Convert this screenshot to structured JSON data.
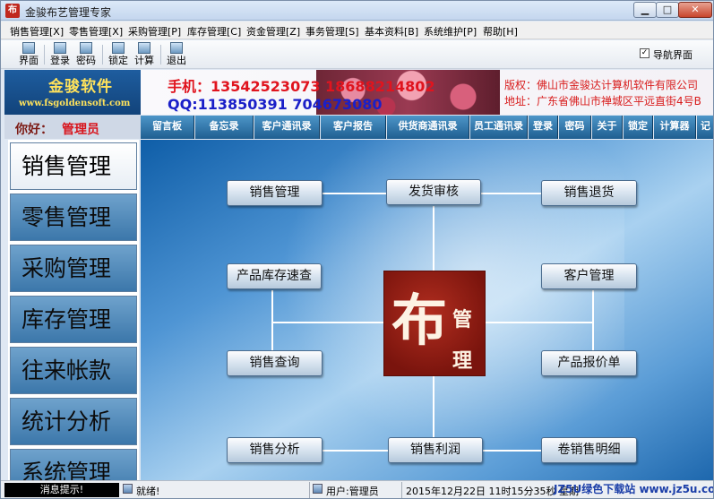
{
  "window": {
    "title": "金骏布艺管理专家",
    "icon_text": "布"
  },
  "window_controls": {
    "minimize": "▁",
    "maximize": "□",
    "close": "✕"
  },
  "menu": [
    "销售管理[X]",
    "零售管理[X]",
    "采购管理[P]",
    "库存管理[C]",
    "资金管理[Z]",
    "事务管理[S]",
    "基本资料[B]",
    "系统维护[P]",
    "帮助[H]"
  ],
  "toolbar": {
    "items": [
      {
        "label": "界面",
        "icon": "interface-icon"
      },
      {
        "label": "登录",
        "icon": "login-icon"
      },
      {
        "label": "密码",
        "icon": "password-icon"
      },
      {
        "label": "锁定",
        "icon": "lock-icon"
      },
      {
        "label": "计算",
        "icon": "calculator-icon"
      },
      {
        "label": "退出",
        "icon": "exit-icon"
      }
    ],
    "nav_checkbox": {
      "checked": true,
      "mark": "✓",
      "label": "导航界面"
    }
  },
  "banner": {
    "logo_name": "金骏软件",
    "logo_url": "www.fsgoldensoft.com",
    "phone": "手机：13542523073  18688214802",
    "qq": "QQ:113850391  704673080",
    "copyright": "版权：佛山市金骏达计算机软件有限公司",
    "address": "地址：广东省佛山市禅城区平远直街4号B"
  },
  "greeting": {
    "label": "你好：",
    "user": "管理员"
  },
  "quick_buttons": [
    "留言板",
    "备忘录",
    "客户通讯录",
    "客户报告",
    "供货商通讯录",
    "员工通讯录",
    "登录",
    "密码",
    "关于",
    "锁定",
    "计算器",
    "记"
  ],
  "sidebar": {
    "items": [
      {
        "label": "销售管理",
        "active": true
      },
      {
        "label": "零售管理",
        "active": false
      },
      {
        "label": "采购管理",
        "active": false
      },
      {
        "label": "库存管理",
        "active": false
      },
      {
        "label": "往来帐款",
        "active": false
      },
      {
        "label": "统计分析",
        "active": false
      },
      {
        "label": "系统管理",
        "active": false
      }
    ]
  },
  "flow": {
    "buttons": {
      "sales_mgmt": "销售管理",
      "ship_review": "发货审核",
      "sales_return": "销售退货",
      "stock_quick": "产品库存速查",
      "customer_mgmt": "客户管理",
      "sales_query": "销售查询",
      "price_list": "产品报价单",
      "sales_analysis": "销售分析",
      "sales_profit": "销售利润",
      "roll_detail": "卷销售明细"
    },
    "center_logo": {
      "big": "布",
      "top": "管",
      "bottom": "理"
    }
  },
  "status": {
    "message_label": "消息提示!",
    "ready": "就绪!",
    "user": "用户:管理员",
    "datetime": "2015年12月22日  11时15分35秒  星期",
    "watermark": "JZ5U绿色下载站 www.jz5u.com"
  },
  "colors": {
    "accent_blue": "#1f5f91",
    "brand_red": "#d8141c",
    "banner_yellow": "#ffe25b"
  }
}
